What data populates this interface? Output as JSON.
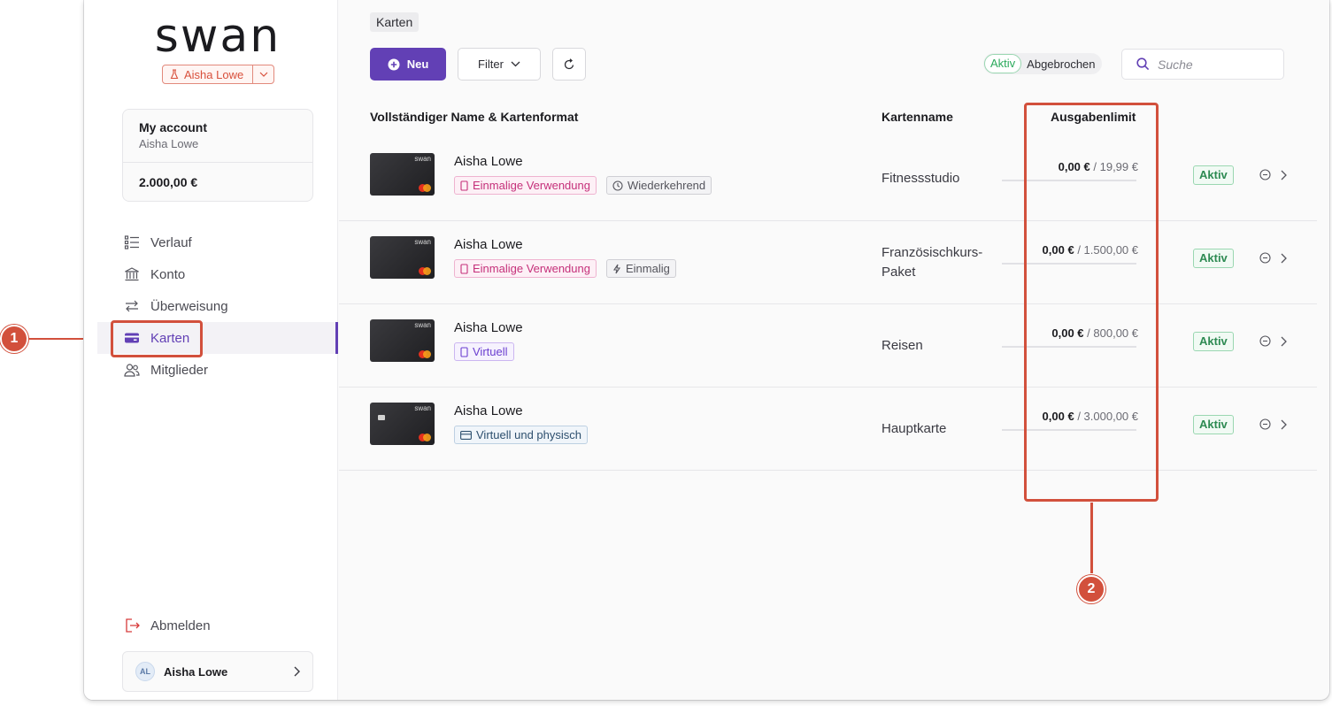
{
  "app": {
    "logo_text": "swan",
    "project_name": "Aisha Lowe"
  },
  "account": {
    "title": "My account",
    "owner": "Aisha Lowe",
    "balance": "2.000,00 €"
  },
  "nav": {
    "items": [
      {
        "label": "Verlauf",
        "icon": "list-icon"
      },
      {
        "label": "Konto",
        "icon": "bank-icon"
      },
      {
        "label": "Überweisung",
        "icon": "transfer-icon"
      },
      {
        "label": "Karten",
        "icon": "card-icon",
        "active": true
      },
      {
        "label": "Mitglieder",
        "icon": "members-icon"
      }
    ],
    "logout": "Abmelden"
  },
  "user": {
    "initials": "AL",
    "name": "Aisha Lowe"
  },
  "toolbar": {
    "breadcrumb": "Karten",
    "new_label": "Neu",
    "filter_label": "Filter",
    "status_active": "Aktiv",
    "status_cancelled": "Abgebrochen",
    "search_placeholder": "Suche"
  },
  "table": {
    "headers": {
      "name": "Vollständiger Name & Kartenformat",
      "cardname": "Kartenname",
      "limit": "Ausgabenlimit"
    },
    "rows": [
      {
        "holder": "Aisha Lowe",
        "card_brand": "swan",
        "tags": [
          {
            "label": "Einmalige Verwendung",
            "style": "pink",
            "icon": "phone-icon"
          },
          {
            "label": "Wiederkehrend",
            "style": "gray",
            "icon": "clock-icon"
          }
        ],
        "cardname_lines": [
          "Fitnessstudio"
        ],
        "spent": "0,00 €",
        "limit": "/ 19,99 €",
        "status": "Aktiv"
      },
      {
        "holder": "Aisha Lowe",
        "card_brand": "swan",
        "tags": [
          {
            "label": "Einmalige Verwendung",
            "style": "pink",
            "icon": "phone-icon"
          },
          {
            "label": "Einmalig",
            "style": "gray",
            "icon": "bolt-icon"
          }
        ],
        "cardname_lines": [
          "Französischkurs-",
          "Paket"
        ],
        "spent": "0,00 €",
        "limit": "/ 1.500,00 €",
        "status": "Aktiv"
      },
      {
        "holder": "Aisha Lowe",
        "card_brand": "swan",
        "tags": [
          {
            "label": "Virtuell",
            "style": "purple",
            "icon": "phone-icon"
          }
        ],
        "cardname_lines": [
          "Reisen"
        ],
        "spent": "0,00 €",
        "limit": "/ 800,00 €",
        "status": "Aktiv"
      },
      {
        "holder": "Aisha Lowe",
        "card_brand": "swan",
        "tags": [
          {
            "label": "Virtuell und physisch",
            "style": "blue",
            "icon": "card-outline-icon"
          }
        ],
        "cardname_lines": [
          "Hauptkarte"
        ],
        "spent": "0,00 €",
        "limit": "/ 3.000,00 €",
        "status": "Aktiv"
      }
    ]
  },
  "annotations": {
    "callout_1": "1",
    "callout_2": "2",
    "color": "#d2503c"
  },
  "colors": {
    "accent": "#6240b5",
    "active_green": "#2aa95b"
  }
}
